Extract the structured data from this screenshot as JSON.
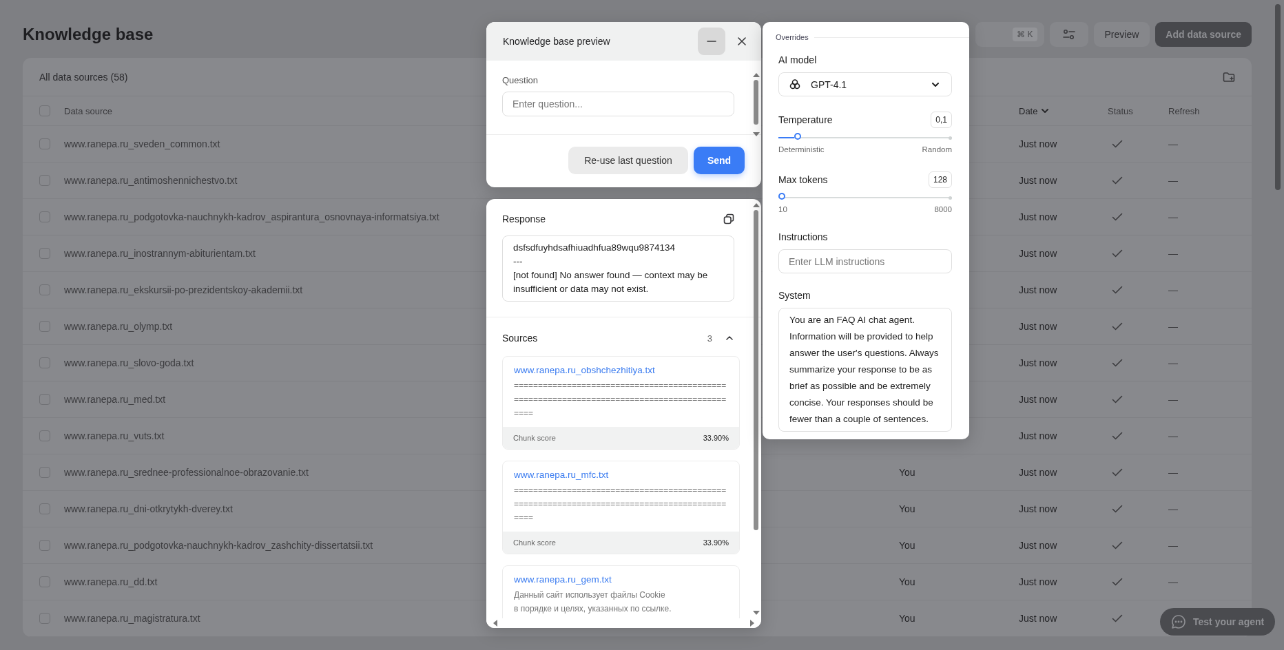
{
  "page": {
    "title": "Knowledge base"
  },
  "toolbar": {
    "shortcut": "⌘ K",
    "preview_button": "Preview",
    "add_button": "Add data source"
  },
  "data_sources": {
    "title": "All data sources (58)",
    "all_checked": false,
    "columns": [
      {
        "label": "Data source",
        "sorted": false
      },
      {
        "label": "Date",
        "sorted": true
      },
      {
        "label": "Status",
        "sorted": false
      },
      {
        "label": "Refresh",
        "sorted": false
      }
    ],
    "rows": [
      {
        "name": "www.ranepa.ru_sveden_common.txt",
        "date": "Just now",
        "synced": true,
        "refresh": "—",
        "checked": false
      },
      {
        "name": "www.ranepa.ru_antimoshennichestvo.txt",
        "date": "Just now",
        "synced": true,
        "refresh": "—",
        "checked": false
      },
      {
        "name": "www.ranepa.ru_podgotovka-nauchnykh-kadrov_aspirantura_osnovnaya-informatsiya.txt",
        "date": "Just now",
        "synced": true,
        "refresh": "—",
        "checked": false
      },
      {
        "name": "www.ranepa.ru_inostrannym-abiturientam.txt",
        "date": "Just now",
        "synced": true,
        "refresh": "—",
        "checked": false
      },
      {
        "name": "www.ranepa.ru_ekskursii-po-prezidentskoy-akademii.txt",
        "date": "Just now",
        "synced": true,
        "refresh": "—",
        "checked": false
      },
      {
        "name": "www.ranepa.ru_olymp.txt",
        "date": "Just now",
        "synced": true,
        "refresh": "—",
        "checked": false
      },
      {
        "name": "www.ranepa.ru_slovo-goda.txt",
        "date": "Just now",
        "synced": true,
        "refresh": "—",
        "checked": false
      },
      {
        "name": "www.ranepa.ru_med.txt",
        "date": "Just now",
        "synced": true,
        "refresh": "—",
        "checked": false
      },
      {
        "name": "www.ranepa.ru_vuts.txt",
        "date": "Just now",
        "synced": true,
        "refresh": "—",
        "checked": false
      },
      {
        "name": "www.ranepa.ru_srednee-professionalnoe-obrazovanie.txt",
        "owner": "You",
        "date": "Just now",
        "synced": true,
        "refresh": "—",
        "checked": false
      },
      {
        "name": "www.ranepa.ru_dni-otkrytykh-dverey.txt",
        "owner": "You",
        "date": "Just now",
        "synced": true,
        "refresh": "—",
        "checked": false
      },
      {
        "name": "www.ranepa.ru_podgotovka-nauchnykh-kadrov_zashchity-dissertatsii.txt",
        "owner": "You",
        "date": "Just now",
        "synced": true,
        "refresh": "—",
        "checked": false
      },
      {
        "name": "www.ranepa.ru_dd.txt",
        "owner": "You",
        "date": "Just now",
        "synced": true,
        "refresh": "—",
        "checked": false
      },
      {
        "name": "www.ranepa.ru_magistratura.txt",
        "owner": "You",
        "date": "Just now",
        "synced": true,
        "checked": false
      }
    ]
  },
  "preview": {
    "title": "Knowledge base preview",
    "question": {
      "label": "Question",
      "placeholder": "Enter question..."
    },
    "buttons": [
      {
        "label": "Re-use last question",
        "kind": "secondary"
      },
      {
        "label": "Send",
        "kind": "primary"
      }
    ],
    "response": {
      "label": "Response",
      "text": "dsfsdfuyhdsafhiuadhfua89wqu9874134\n---\n[not found] No answer found — context may be insufficient or data may not exist."
    },
    "sources": {
      "label": "Sources",
      "count": "3",
      "expanded": true,
      "items": [
        {
          "title": "www.ranepa.ru_obshchezhitiya.txt",
          "excerpt": "============================================================================================",
          "score_label": "Chunk score",
          "score": "33.90%"
        },
        {
          "title": "www.ranepa.ru_mfc.txt",
          "excerpt": "============================================================================================",
          "score_label": "Chunk score",
          "score": "33.90%"
        },
        {
          "title": "www.ranepa.ru_gem.txt",
          "excerpt": "Данный сайт использует файлы Cookie\nв порядке и целях, указанных по ссылке."
        }
      ]
    }
  },
  "overrides": {
    "legend": "Overrides",
    "model": {
      "label": "AI model",
      "value": "GPT-4.1"
    },
    "sliders": [
      {
        "label": "Temperature",
        "value": "0,1",
        "level": 0.09,
        "min_label": "Deterministic",
        "max_label": "Random"
      },
      {
        "label": "Max tokens",
        "value": "128",
        "level": 0.0,
        "min_label": "10",
        "max_label": "8000"
      }
    ],
    "instructions": {
      "label": "Instructions",
      "placeholder": "Enter LLM instructions"
    },
    "system": {
      "label": "System",
      "value": "You are an FAQ AI chat agent. Information will be provided to help answer the user's questions. Always summarize your response to be as brief as possible and be extremely concise. Your responses should be fewer than a couple of sentences."
    }
  },
  "agent_button": {
    "label": "Test your agent"
  }
}
